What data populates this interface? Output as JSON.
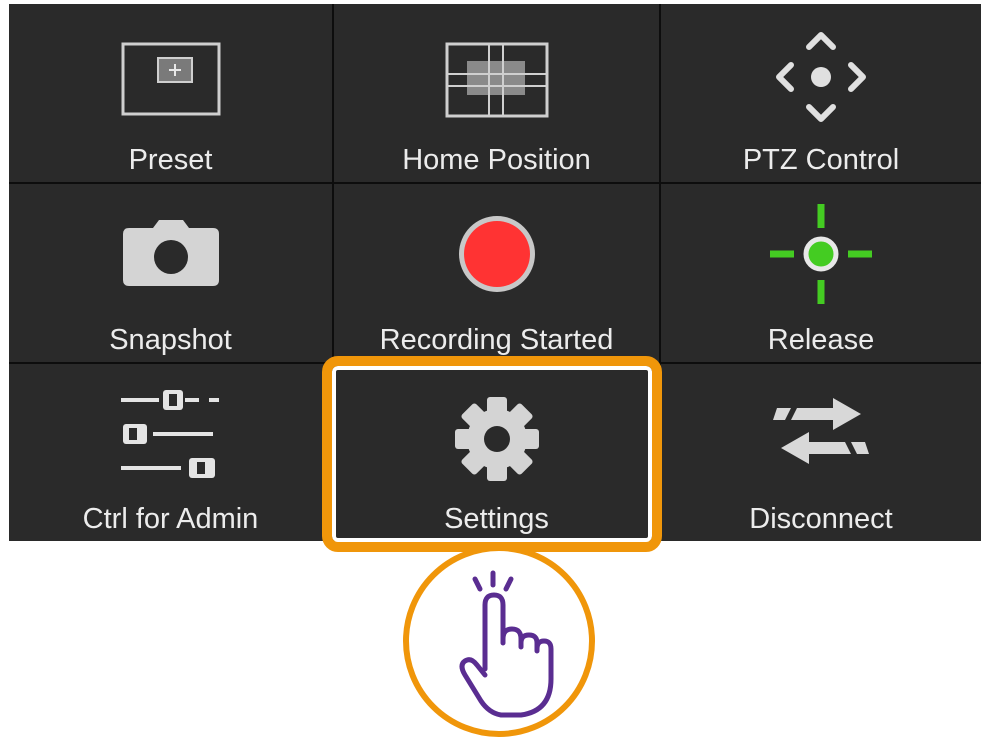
{
  "tiles": [
    {
      "id": "preset",
      "label": "Preset",
      "icon": "preset-icon",
      "interactable": true
    },
    {
      "id": "home-position",
      "label": "Home Position",
      "icon": "home-position-icon"
    },
    {
      "id": "ptz-control",
      "label": "PTZ Control",
      "icon": "ptz-arrows-icon"
    },
    {
      "id": "snapshot",
      "label": "Snapshot",
      "icon": "camera-icon"
    },
    {
      "id": "recording",
      "label": "Recording Started",
      "icon": "record-icon"
    },
    {
      "id": "release",
      "label": "Release",
      "icon": "crosshair-icon"
    },
    {
      "id": "ctrl-admin",
      "label": "Ctrl for Admin",
      "icon": "sliders-icon"
    },
    {
      "id": "settings",
      "label": "Settings",
      "icon": "gear-icon"
    },
    {
      "id": "disconnect",
      "label": "Disconnect",
      "icon": "swap-arrows-icon"
    }
  ],
  "colors": {
    "panel_bg": "#2a2a2a",
    "label": "#ececec",
    "highlight": "#f0960a",
    "record": "#ff3333",
    "release_green": "#44cc22",
    "hand": "#5a2d91"
  },
  "highlighted_tile": "settings",
  "gesture": "tap-hand-icon"
}
